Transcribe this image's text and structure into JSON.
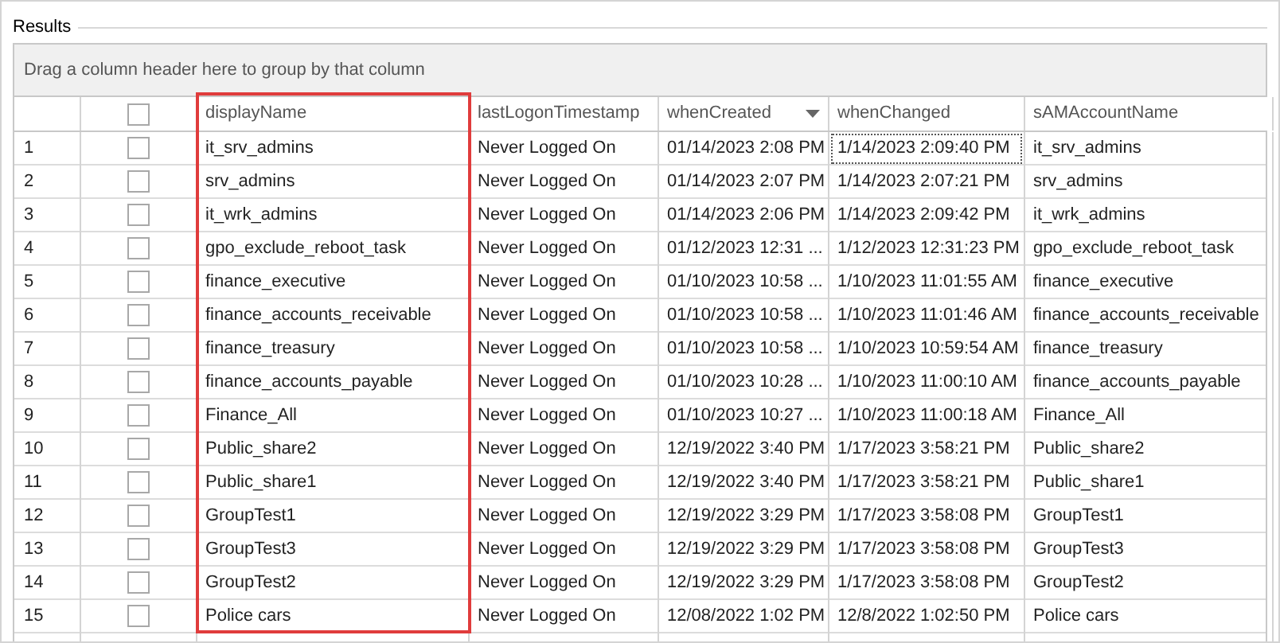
{
  "panel": {
    "title": "Results"
  },
  "group_panel": {
    "hint": "Drag a column header here to group by that column"
  },
  "header_checkbox": {
    "checked": false
  },
  "columns": [
    {
      "label": "displayName",
      "highlighted": true,
      "sorted_descending": false
    },
    {
      "label": "lastLogonTimestamp",
      "highlighted": false,
      "sorted_descending": false
    },
    {
      "label": "whenCreated",
      "highlighted": false,
      "sorted_descending": true
    },
    {
      "label": "whenChanged",
      "highlighted": false,
      "sorted_descending": false
    },
    {
      "label": "sAMAccountName",
      "highlighted": false,
      "sorted_descending": false
    }
  ],
  "rows": [
    {
      "number": "1",
      "checked": false,
      "focused": true,
      "cells": [
        "it_srv_admins",
        "Never Logged On",
        "01/14/2023 2:08 PM",
        "1/14/2023 2:09:40 PM",
        "it_srv_admins"
      ]
    },
    {
      "number": "2",
      "checked": false,
      "focused": false,
      "cells": [
        "srv_admins",
        "Never Logged On",
        "01/14/2023 2:07 PM",
        "1/14/2023 2:07:21 PM",
        "srv_admins"
      ]
    },
    {
      "number": "3",
      "checked": false,
      "focused": false,
      "cells": [
        "it_wrk_admins",
        "Never Logged On",
        "01/14/2023 2:06 PM",
        "1/14/2023 2:09:42 PM",
        "it_wrk_admins"
      ]
    },
    {
      "number": "4",
      "checked": false,
      "focused": false,
      "cells": [
        "gpo_exclude_reboot_task",
        "Never Logged On",
        "01/12/2023 12:31 ...",
        "1/12/2023 12:31:23 PM",
        "gpo_exclude_reboot_task"
      ]
    },
    {
      "number": "5",
      "checked": false,
      "focused": false,
      "cells": [
        "finance_executive",
        "Never Logged On",
        "01/10/2023 10:58 ...",
        "1/10/2023 11:01:55 AM",
        "finance_executive"
      ]
    },
    {
      "number": "6",
      "checked": false,
      "focused": false,
      "cells": [
        "finance_accounts_receivable",
        "Never Logged On",
        "01/10/2023 10:58 ...",
        "1/10/2023 11:01:46 AM",
        "finance_accounts_receivable"
      ]
    },
    {
      "number": "7",
      "checked": false,
      "focused": false,
      "cells": [
        "finance_treasury",
        "Never Logged On",
        "01/10/2023 10:58 ...",
        "1/10/2023 10:59:54 AM",
        "finance_treasury"
      ]
    },
    {
      "number": "8",
      "checked": false,
      "focused": false,
      "cells": [
        "finance_accounts_payable",
        "Never Logged On",
        "01/10/2023 10:28 ...",
        "1/10/2023 11:00:10 AM",
        "finance_accounts_payable"
      ]
    },
    {
      "number": "9",
      "checked": false,
      "focused": false,
      "cells": [
        "Finance_All",
        "Never Logged On",
        "01/10/2023 10:27 ...",
        "1/10/2023 11:00:18 AM",
        "Finance_All"
      ]
    },
    {
      "number": "10",
      "checked": false,
      "focused": false,
      "cells": [
        "Public_share2",
        "Never Logged On",
        "12/19/2022 3:40 PM",
        "1/17/2023 3:58:21 PM",
        "Public_share2"
      ]
    },
    {
      "number": "11",
      "checked": false,
      "focused": false,
      "cells": [
        "Public_share1",
        "Never Logged On",
        "12/19/2022 3:40 PM",
        "1/17/2023 3:58:21 PM",
        "Public_share1"
      ]
    },
    {
      "number": "12",
      "checked": false,
      "focused": false,
      "cells": [
        "GroupTest1",
        "Never Logged On",
        "12/19/2022 3:29 PM",
        "1/17/2023 3:58:08 PM",
        "GroupTest1"
      ]
    },
    {
      "number": "13",
      "checked": false,
      "focused": false,
      "cells": [
        "GroupTest3",
        "Never Logged On",
        "12/19/2022 3:29 PM",
        "1/17/2023 3:58:08 PM",
        "GroupTest3"
      ]
    },
    {
      "number": "14",
      "checked": false,
      "focused": false,
      "cells": [
        "GroupTest2",
        "Never Logged On",
        "12/19/2022 3:29 PM",
        "1/17/2023 3:58:08 PM",
        "GroupTest2"
      ]
    },
    {
      "number": "15",
      "checked": false,
      "focused": false,
      "cells": [
        "Police cars",
        "Never Logged On",
        "12/08/2022 1:02 PM",
        "12/8/2022 1:02:50 PM",
        "Police cars"
      ]
    }
  ]
}
